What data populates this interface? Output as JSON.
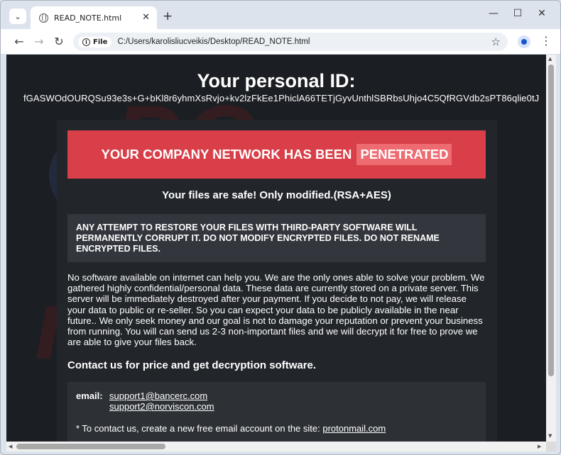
{
  "browser": {
    "tab_title": "READ_NOTE.html",
    "tab_close": "✕",
    "new_tab": "+",
    "controls": {
      "minimize": "—",
      "maximize": "☐",
      "close": "✕"
    },
    "chip_label": "File",
    "url": "C:/Users/karolisliucveikis/Desktop/READ_NOTE.html"
  },
  "note": {
    "id_title": "Your personal ID:",
    "id_value": "fGASWOdOURQSu93e3s+G+bKl8r6yhmXsRvjo+kv2lzFkEe1PhiclA66TETjGyvUnthlSBRbsUhjo4C5QfRGVdb2sPT86qlie0tJ",
    "banner_text": "YOUR COMPANY NETWORK HAS BEEN",
    "banner_highlight": "PENETRATED",
    "safe_line": "Your files are safe! Only modified.(RSA+AES)",
    "warning": "ANY ATTEMPT TO RESTORE YOUR FILES WITH THIRD-PARTY SOFTWARE WILL PERMANENTLY CORRUPT IT. DO NOT MODIFY ENCRYPTED FILES. DO NOT RENAME ENCRYPTED FILES.",
    "body": "No software available on internet can help you. We are the only ones able to solve your problem. We gathered highly confidential/personal data. These data are currently stored on a private server. This server will be immediately destroyed after your payment. If you decide to not pay, we will release your data to public or re-seller. So you can expect your data to be publicly available in the near future.. We only seek money and our goal is not to damage your reputation or prevent your business from running. You will can send us 2-3 non-important files and we will decrypt it for free to prove we are able to give your files back.",
    "contact_heading": "Contact us for price and get decryption software.",
    "email_label": "email:",
    "emails": [
      "support1@bancerc.com",
      "support2@norviscon.com"
    ],
    "protonmail_text": "* To contact us, create a new free email account on the site:",
    "protonmail_link": "protonmail.com"
  }
}
